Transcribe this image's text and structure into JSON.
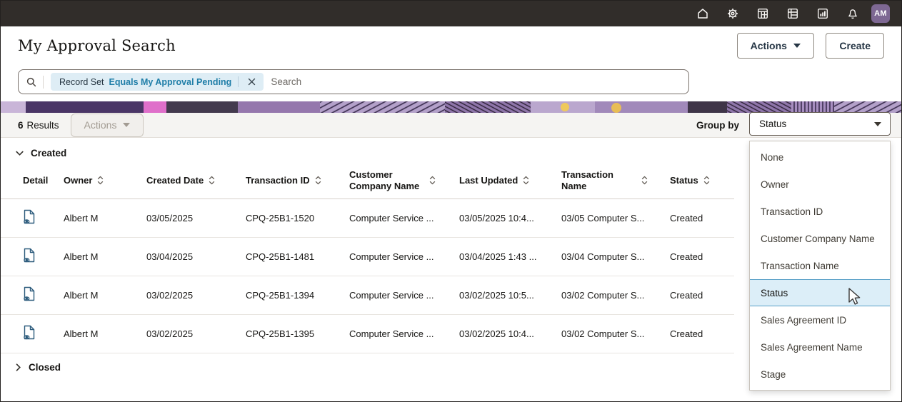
{
  "topbar": {
    "icons": [
      "home-icon",
      "settings-icon",
      "applications-icon",
      "tables-icon",
      "reports-icon",
      "notifications-icon"
    ],
    "avatar_initials": "AM"
  },
  "header": {
    "title": "My Approval Search",
    "actions_label": "Actions",
    "create_label": "Create"
  },
  "search": {
    "chip_field": "Record Set",
    "chip_operator": "Equals My Approval Pending",
    "placeholder": "Search"
  },
  "toolbar": {
    "results_count": "6",
    "results_label": "Results",
    "actions_label": "Actions",
    "group_by_label": "Group by",
    "group_by_value": "Status"
  },
  "groups": {
    "created_label": "Created",
    "closed_label": "Closed"
  },
  "table": {
    "columns": [
      {
        "label": "Detail",
        "sortable": false
      },
      {
        "label": "Owner",
        "sortable": true
      },
      {
        "label": "Created Date",
        "sortable": true
      },
      {
        "label": "Transaction ID",
        "sortable": true
      },
      {
        "label": "Customer Company Name",
        "sortable": true
      },
      {
        "label": "Last Updated",
        "sortable": true
      },
      {
        "label": "Transaction Name",
        "sortable": true
      },
      {
        "label": "Status",
        "sortable": true
      }
    ],
    "rows": [
      {
        "owner": "Albert M",
        "created_date": "03/05/2025",
        "transaction_id": "CPQ-25B1-1520",
        "customer_company_name": "Computer Service ...",
        "last_updated": "03/05/2025 10:4...",
        "transaction_name": "03/05 Computer S...",
        "status": "Created"
      },
      {
        "owner": "Albert M",
        "created_date": "03/04/2025",
        "transaction_id": "CPQ-25B1-1481",
        "customer_company_name": "Computer Service ...",
        "last_updated": "03/04/2025 1:43 ...",
        "transaction_name": "03/04 Computer S...",
        "status": "Created"
      },
      {
        "owner": "Albert M",
        "created_date": "03/02/2025",
        "transaction_id": "CPQ-25B1-1394",
        "customer_company_name": "Computer Service ...",
        "last_updated": "03/02/2025 10:5...",
        "transaction_name": "03/02 Computer S...",
        "status": "Created"
      },
      {
        "owner": "Albert M",
        "created_date": "03/02/2025",
        "transaction_id": "CPQ-25B1-1395",
        "customer_company_name": "Computer Service ...",
        "last_updated": "03/02/2025 10:4...",
        "transaction_name": "03/02 Computer S...",
        "status": "Created"
      }
    ]
  },
  "dropdown": {
    "items": [
      "None",
      "Owner",
      "Transaction ID",
      "Customer Company Name",
      "Transaction Name",
      "Status",
      "Sales Agreement ID",
      "Sales Agreement Name",
      "Stage"
    ],
    "selected": "Status"
  },
  "colors": {
    "topbar_bg": "#312d2a",
    "avatar_bg": "#7e6893",
    "chip_bg": "#deedf5",
    "chip_operator_text": "#1f7ea8",
    "selected_item_bg": "#dceef8",
    "selected_item_border": "#59a0c8",
    "toolbar_bg": "#f5f4f2",
    "strip_purple": "#9b7fb4",
    "strip_yellow": "#efc95c"
  }
}
